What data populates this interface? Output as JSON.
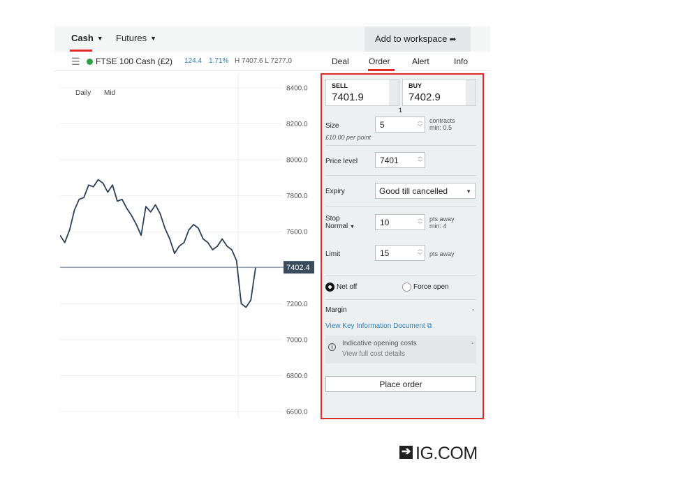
{
  "nav": {
    "cash_label": "Cash",
    "futures_label": "Futures",
    "add_workspace_label": "Add to workspace"
  },
  "instrument": {
    "name": "FTSE 100 Cash (£2)",
    "change": "124.4",
    "change_pct": "1.71%",
    "high_low": "H 7407.6 L 7277.0"
  },
  "tabs": {
    "deal": "Deal",
    "order": "Order",
    "alert": "Alert",
    "info": "Info"
  },
  "chart": {
    "label_period": "Daily",
    "label_price_type": "Mid",
    "y_ticks": [
      "8400.0",
      "8200.0",
      "8000.0",
      "7800.0",
      "7600.0",
      "7400.0",
      "7200.0",
      "7000.0",
      "6800.0",
      "6600.0"
    ],
    "current_price": "7402.4",
    "line_color": "#2b3f55",
    "tag_color": "#3b4b5e",
    "chart_data": {
      "type": "line",
      "ylim": [
        6600,
        8400
      ],
      "values": [
        7580,
        7540,
        7610,
        7720,
        7780,
        7790,
        7860,
        7850,
        7890,
        7870,
        7820,
        7860,
        7770,
        7780,
        7730,
        7690,
        7640,
        7580,
        7740,
        7710,
        7750,
        7700,
        7620,
        7560,
        7480,
        7520,
        7540,
        7610,
        7640,
        7620,
        7560,
        7540,
        7500,
        7520,
        7560,
        7520,
        7500,
        7440,
        7200,
        7180,
        7220,
        7400
      ],
      "series_color": "#2b3f55"
    }
  },
  "order_panel": {
    "sell_label": "SELL",
    "sell_price": "7401.9",
    "buy_label": "BUY",
    "buy_price": "7402.9",
    "spread": "1",
    "size_label": "Size",
    "size_value": "5",
    "size_unit": "contracts",
    "size_min": "min: 0.5",
    "per_point": "£10.00 per point",
    "price_level_label": "Price level",
    "price_level_value": "7401",
    "expiry_label": "Expiry",
    "expiry_value": "Good till cancelled",
    "stop_label": "Stop",
    "stop_type": "Normal",
    "stop_value": "10",
    "stop_unit": "pts away",
    "stop_min": "min: 4",
    "limit_label": "Limit",
    "limit_value": "15",
    "limit_unit": "pts away",
    "net_off_label": "Net off",
    "force_open_label": "Force open",
    "margin_label": "Margin",
    "margin_value": "-",
    "kid_link": "View Key Information Document",
    "costs_title": "Indicative opening costs",
    "costs_value": "-",
    "costs_link": "View full cost details",
    "place_order_label": "Place order"
  },
  "logo": {
    "text": "IG.COM"
  },
  "colors": {
    "accent_red": "#e02b2b",
    "link_blue": "#2d7fb9",
    "live_green": "#2ea043"
  }
}
